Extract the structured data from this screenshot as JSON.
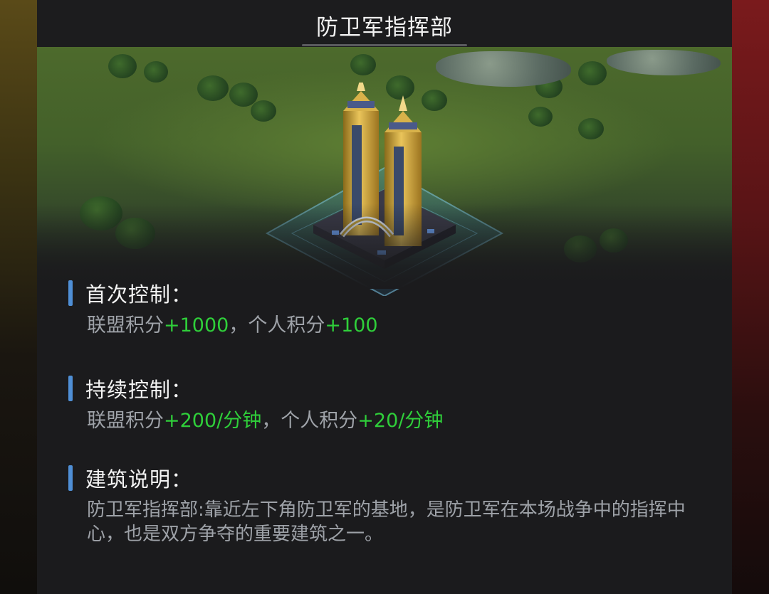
{
  "header": {
    "title": "防卫军指挥部"
  },
  "first_control": {
    "title": "首次控制：",
    "alliance_label": "联盟积分",
    "alliance_value": "+1000",
    "sep": "，",
    "personal_label": "个人积分",
    "personal_value": "+100"
  },
  "continuous_control": {
    "title": "持续控制：",
    "alliance_label": "联盟积分",
    "alliance_value": "+200/分钟",
    "sep": "，",
    "personal_label": "个人积分",
    "personal_value": "+20/分钟"
  },
  "building_desc": {
    "title": "建筑说明：",
    "text": "防卫军指挥部:靠近左下角防卫军的基地，是防卫军在本场战争中的指挥中心，也是双方争夺的重要建筑之一。"
  },
  "colors": {
    "accent_bar": "#4f8fd6",
    "value_green": "#2fcf3a",
    "body_text": "#9ea2a8"
  }
}
